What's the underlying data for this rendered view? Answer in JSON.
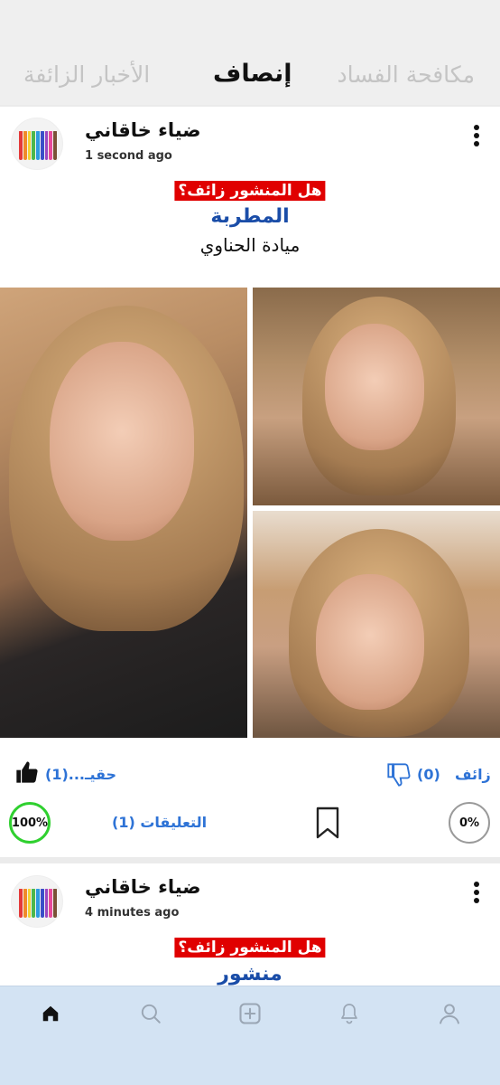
{
  "tabs": {
    "left": "الأخبار الزائفة",
    "middle": "إنصاف",
    "right": "مكافحة الفساد"
  },
  "posts": [
    {
      "author": "ضياء خاقاني",
      "time": "1 second ago",
      "question": "هل المنشور زائف؟",
      "title": "المطربة",
      "subtitle": "ميادة الحناوي",
      "actions": {
        "true_label": "حقيـ...(1)",
        "fake_label": "زائف",
        "fake_count": "(0)",
        "comments_label": "التعليقات (1)",
        "true_percent": "100%",
        "fake_percent": "0%"
      }
    },
    {
      "author": "ضياء خاقاني",
      "time": "4 minutes ago",
      "question": "هل المنشور زائف؟",
      "title": "منشور"
    }
  ],
  "nav": [
    "home-icon",
    "search-icon",
    "add-icon",
    "bell-icon",
    "profile-icon"
  ],
  "colors": {
    "accent": "#2e73d6",
    "title_blue": "#1a4da8",
    "fake_red": "#e00000",
    "ring_green": "#2fd02f",
    "nav_bg": "#d3e3f3"
  }
}
